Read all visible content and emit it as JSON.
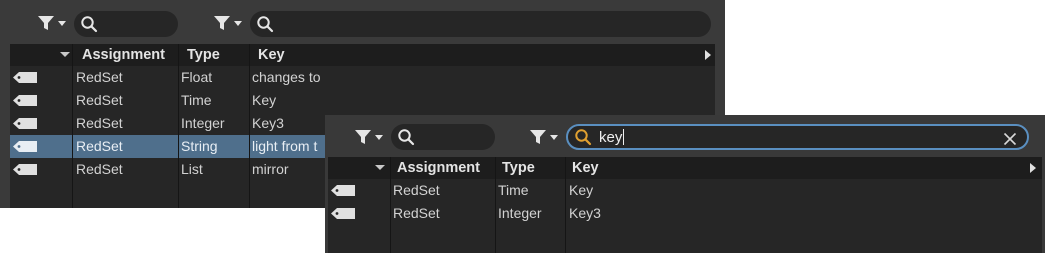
{
  "panel1": {
    "columns": {
      "assignment": "Assignment",
      "type": "Type",
      "key": "Key"
    },
    "rows": [
      {
        "assignment": "RedSet",
        "type": "Float",
        "key": "changes to"
      },
      {
        "assignment": "RedSet",
        "type": "Time",
        "key": "Key"
      },
      {
        "assignment": "RedSet",
        "type": "Integer",
        "key": "Key3"
      },
      {
        "assignment": "RedSet",
        "type": "String",
        "key": "light from t"
      },
      {
        "assignment": "RedSet",
        "type": "List",
        "key": "mirror"
      }
    ],
    "search_left": {
      "value": ""
    },
    "search_right": {
      "value": ""
    }
  },
  "panel2": {
    "columns": {
      "assignment": "Assignment",
      "type": "Type",
      "key": "Key"
    },
    "rows": [
      {
        "assignment": "RedSet",
        "type": "Time",
        "key": "Key"
      },
      {
        "assignment": "RedSet",
        "type": "Integer",
        "key": "Key3"
      }
    ],
    "search_left": {
      "value": ""
    },
    "search_right": {
      "value": "key"
    }
  },
  "colors": {
    "panel_bg": "#3a3a3a",
    "table_bg": "#262626",
    "header_bg": "#1d1d1d",
    "selection": "#4f6f8c",
    "search_focus_border": "#5a8fc0",
    "search_icon_active": "#e0a030"
  },
  "icons": [
    "filter-icon",
    "dropdown-caret-icon",
    "search-icon",
    "clear-icon",
    "tag-icon",
    "sort-arrow-icon",
    "column-menu-arrow-icon"
  ]
}
